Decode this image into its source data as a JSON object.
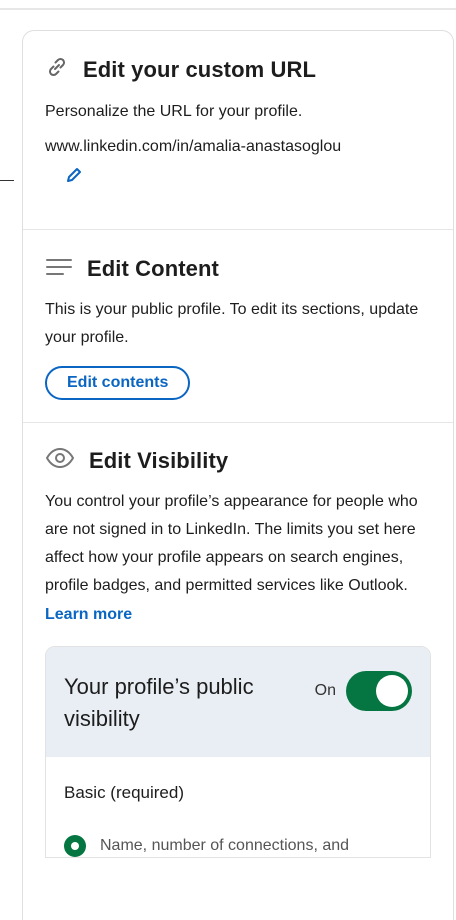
{
  "url_section": {
    "title": "Edit your custom URL",
    "description": "Personalize the URL for your profile.",
    "url": "www.linkedin.com/in/amalia-anastasoglou"
  },
  "content_section": {
    "title": "Edit Content",
    "description": "This is your public profile. To edit its sections, update your profile.",
    "button_label": "Edit contents"
  },
  "visibility_section": {
    "title": "Edit Visibility",
    "description": "You control your profile’s appearance for people who are not signed in to LinkedIn. The limits you set here affect how your profile appears on search engines, profile badges, and permitted services like Outlook.",
    "learn_more": "Learn more",
    "panel": {
      "title": "Your profile’s public visibility",
      "toggle_label": "On",
      "toggle_on": true,
      "basic_label": "Basic (required)",
      "basic_item": "Name, number of connections, and"
    }
  },
  "colors": {
    "brand_blue": "#0a66c2",
    "toggle_green": "#057642",
    "panel_header_bg": "#e9eef4"
  },
  "icons": {
    "url": "link-icon",
    "edit": "pencil-icon",
    "content": "lines-icon",
    "visibility": "eye-icon"
  }
}
